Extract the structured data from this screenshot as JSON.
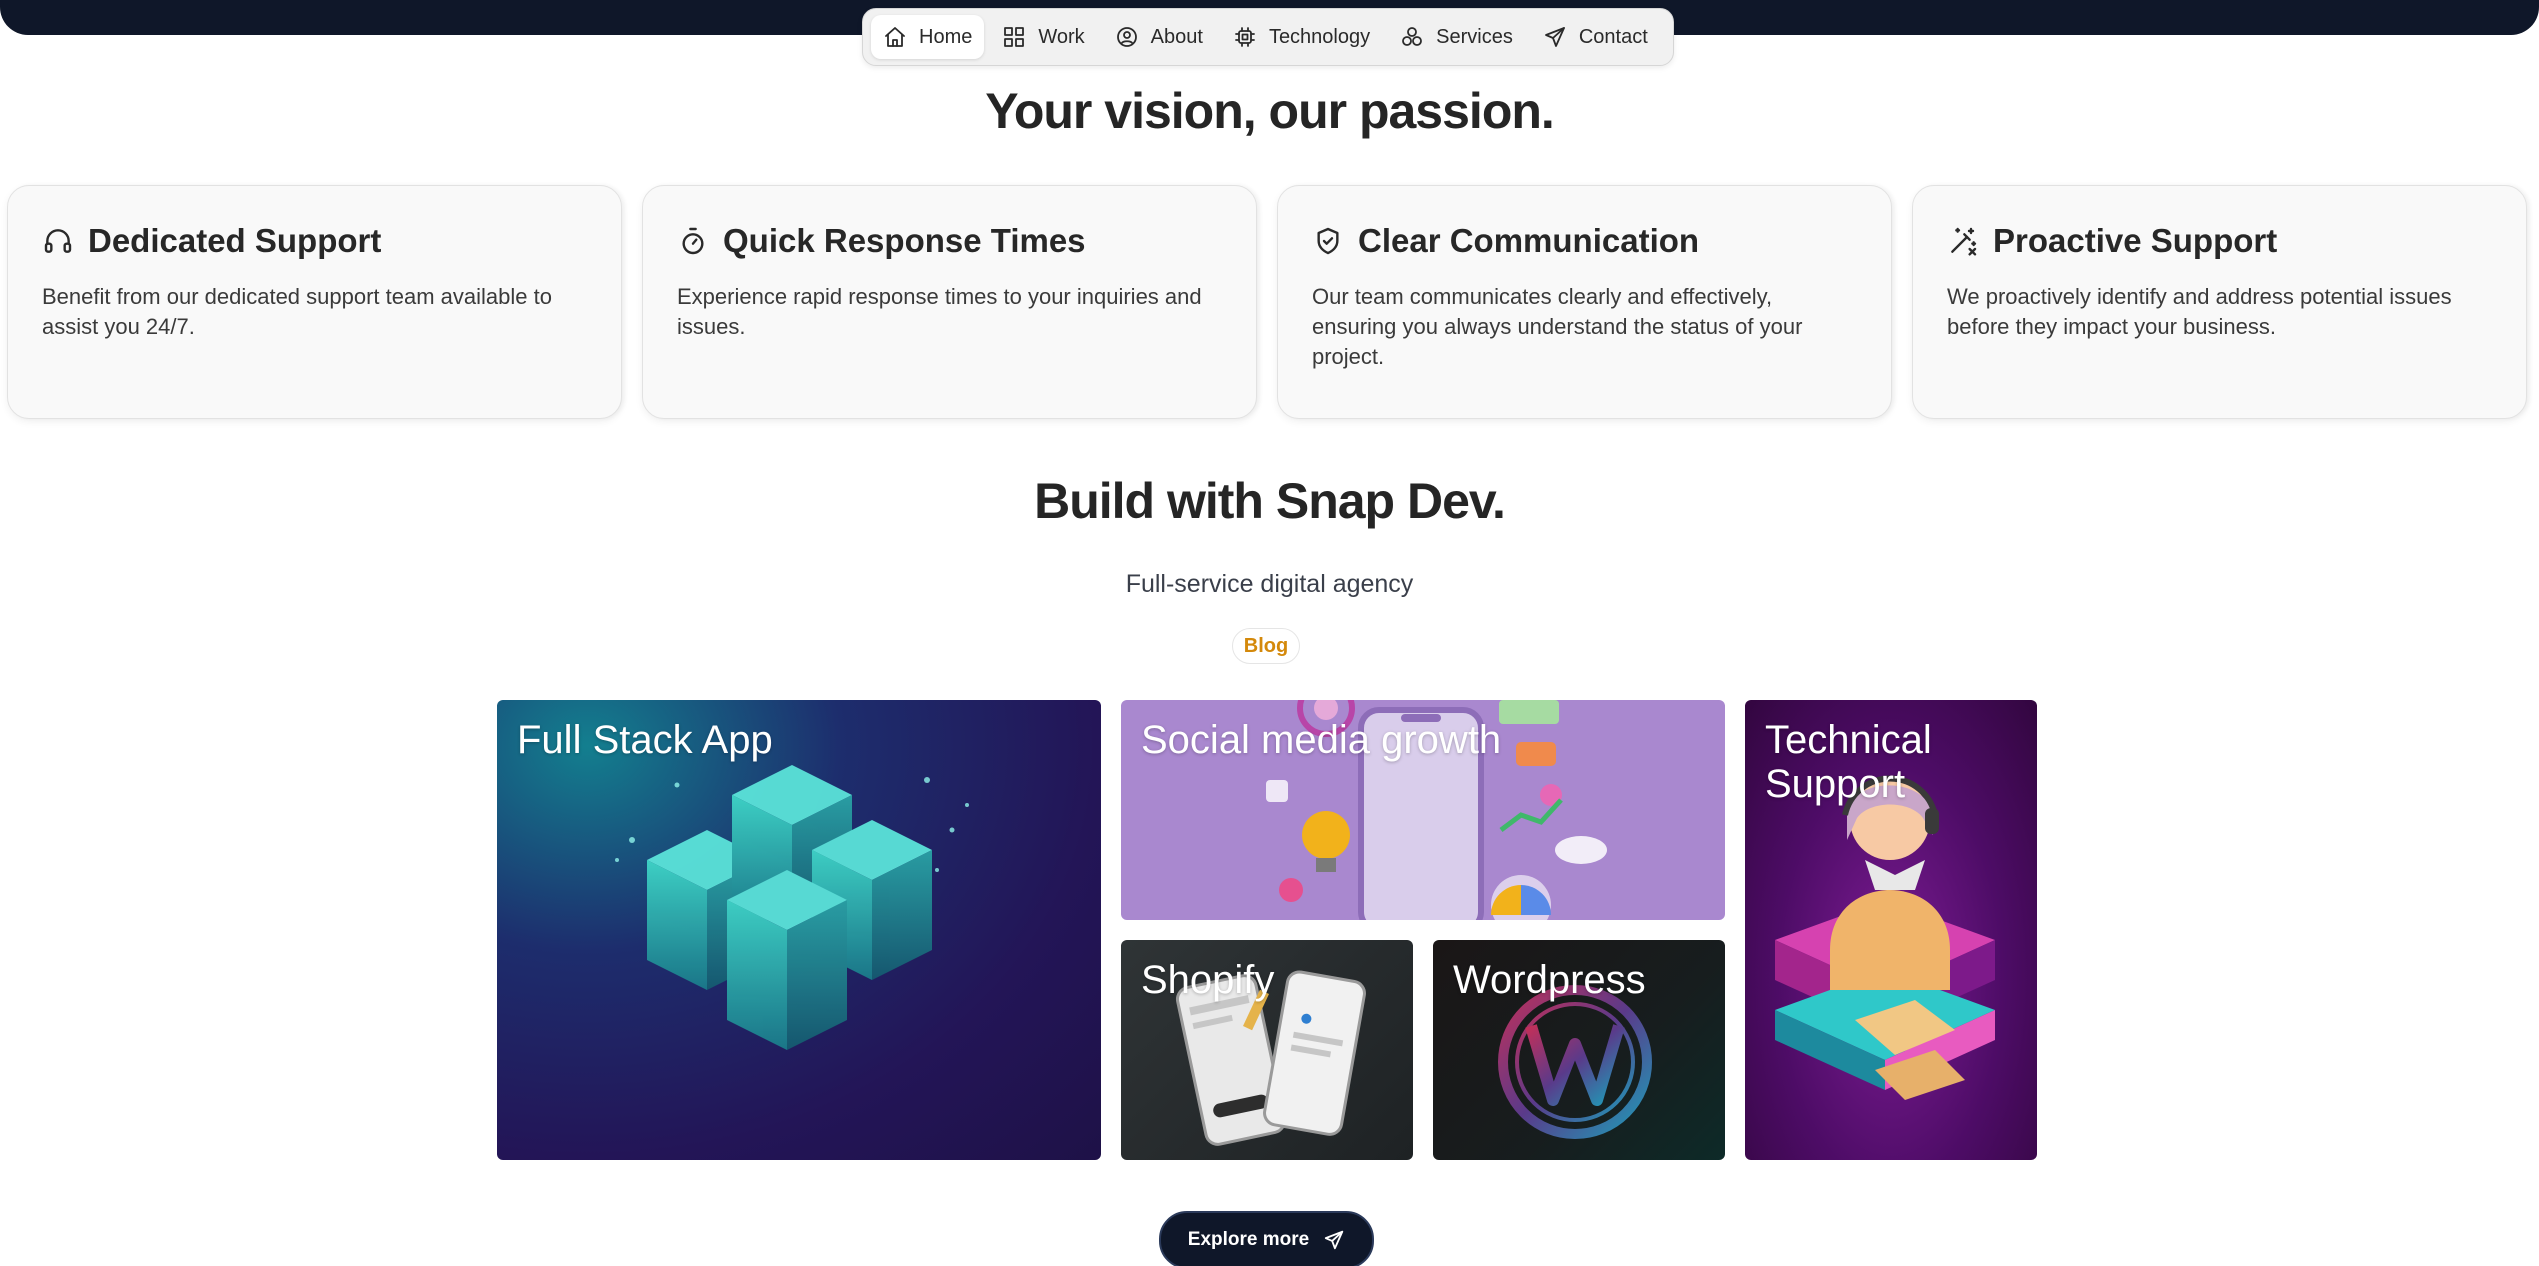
{
  "nav": {
    "items": [
      {
        "label": "Home",
        "icon": "home-icon",
        "active": true
      },
      {
        "label": "Work",
        "icon": "grid-icon",
        "active": false
      },
      {
        "label": "About",
        "icon": "user-circle-icon",
        "active": false
      },
      {
        "label": "Technology",
        "icon": "cpu-icon",
        "active": false
      },
      {
        "label": "Services",
        "icon": "circles-icon",
        "active": false
      },
      {
        "label": "Contact",
        "icon": "send-icon",
        "active": false
      }
    ]
  },
  "hero": {
    "title": "Your vision, our passion."
  },
  "cards": [
    {
      "icon": "headphones-icon",
      "title": "Dedicated Support",
      "text": "Benefit from our dedicated support team available to assist you 24/7."
    },
    {
      "icon": "timer-icon",
      "title": "Quick Response Times",
      "text": "Experience rapid response times to your inquiries and issues."
    },
    {
      "icon": "shield-check-icon",
      "title": "Clear Communication",
      "text": "Our team communicates clearly and effectively, ensuring you always understand the status of your project."
    },
    {
      "icon": "magic-wand-icon",
      "title": "Proactive Support",
      "text": "We proactively identify and address potential issues before they impact your business."
    }
  ],
  "build": {
    "title": "Build with Snap Dev.",
    "subtitle": "Full-service digital agency",
    "badge": "Blog"
  },
  "tiles": {
    "fullstack": "Full Stack App",
    "social": "Social media growth",
    "shopify": "Shopify",
    "wordpress": "Wordpress",
    "technical_line1": "Technical",
    "technical_line2": "Support"
  },
  "explore": {
    "label": "Explore more",
    "icon": "send-icon"
  },
  "colors": {
    "dark_navy": "#0f1729",
    "badge_text": "#d4890b",
    "social_tile": "#a988cf"
  }
}
